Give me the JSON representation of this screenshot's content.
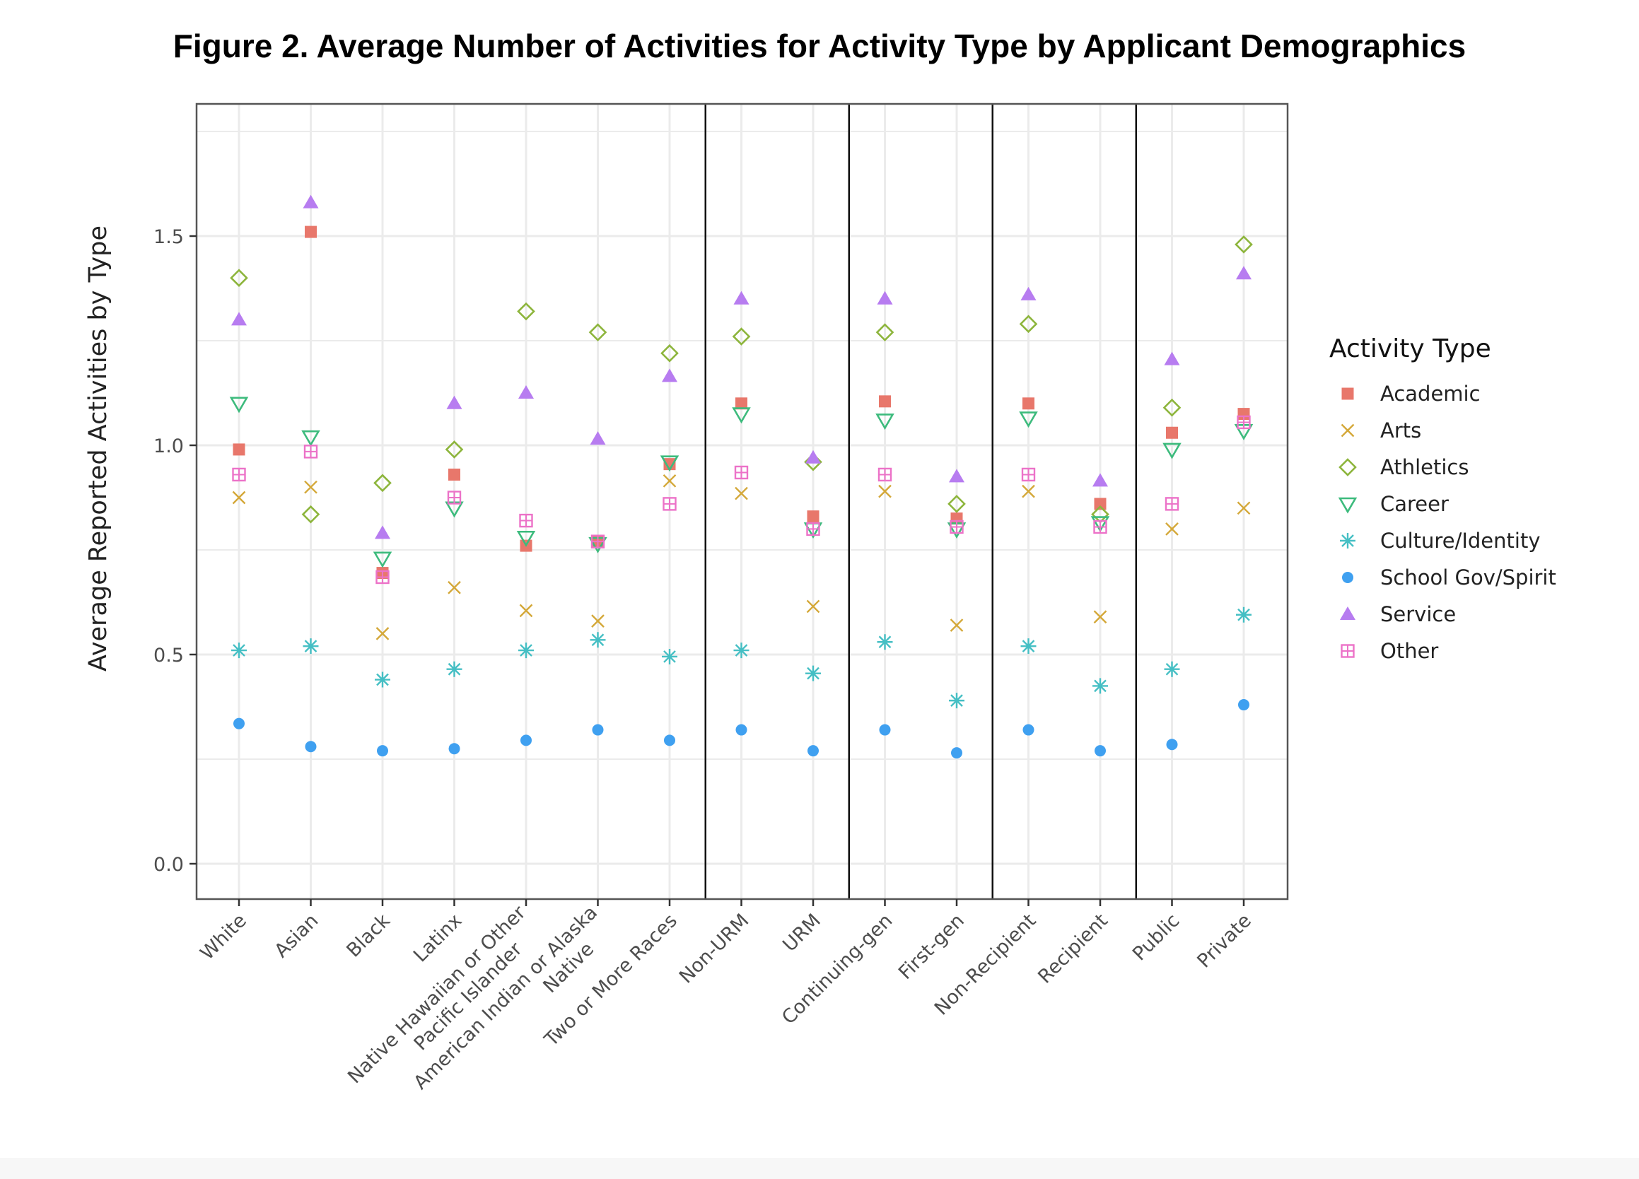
{
  "chart_data": {
    "type": "scatter",
    "title": "Figure 2. Average Number of Activities for Activity Type by Applicant Demographics",
    "xlabel": "",
    "ylabel": "Average Reported Activities by Type",
    "ylim": [
      -0.08,
      1.81
    ],
    "yticks": [
      0.0,
      0.5,
      1.0,
      1.5
    ],
    "ytick_labels": [
      "0.0",
      "0.5",
      "1.0",
      "1.5"
    ],
    "grid": true,
    "legend_title": "Activity Type",
    "legend_position": "right",
    "categories": [
      "White",
      "Asian",
      "Black",
      "Latinx",
      "Native Hawaiian or Other\nPacific Islander",
      "American Indian or Alaska\nNative",
      "Two or More Races",
      "Non-URM",
      "URM",
      "Continuing-gen",
      "First-gen",
      "Non-Recipient",
      "Recipient",
      "Public",
      "Private"
    ],
    "group_separators_after": [
      6,
      8,
      10,
      12
    ],
    "series": [
      {
        "name": "Academic",
        "shape": "square",
        "color": "#E8776B",
        "values": [
          0.99,
          1.51,
          0.695,
          0.93,
          0.76,
          0.77,
          0.955,
          1.1,
          0.83,
          1.105,
          0.825,
          1.1,
          0.86,
          1.03,
          1.075
        ]
      },
      {
        "name": "Arts",
        "shape": "x",
        "color": "#D4A839",
        "values": [
          0.875,
          0.9,
          0.55,
          0.66,
          0.605,
          0.58,
          0.915,
          0.885,
          0.615,
          0.89,
          0.57,
          0.89,
          0.59,
          0.8,
          0.85
        ]
      },
      {
        "name": "Athletics",
        "shape": "diamond-open",
        "color": "#8DB53C",
        "values": [
          1.4,
          0.835,
          0.91,
          0.99,
          1.32,
          1.27,
          1.22,
          1.26,
          0.96,
          1.27,
          0.86,
          1.29,
          0.835,
          1.09,
          1.48
        ]
      },
      {
        "name": "Career",
        "shape": "triangle-down-open",
        "color": "#3DBB7D",
        "values": [
          1.1,
          1.02,
          0.73,
          0.85,
          0.78,
          0.765,
          0.96,
          1.075,
          0.8,
          1.06,
          0.8,
          1.065,
          0.815,
          0.99,
          1.035
        ]
      },
      {
        "name": "Culture/Identity",
        "shape": "asterisk",
        "color": "#45BFC4",
        "values": [
          0.51,
          0.52,
          0.44,
          0.465,
          0.51,
          0.535,
          0.495,
          0.51,
          0.455,
          0.53,
          0.39,
          0.52,
          0.425,
          0.465,
          0.595
        ]
      },
      {
        "name": "School Gov/Spirit",
        "shape": "circle",
        "color": "#3FA0F0",
        "values": [
          0.335,
          0.28,
          0.27,
          0.275,
          0.295,
          0.32,
          0.295,
          0.32,
          0.27,
          0.32,
          0.265,
          0.32,
          0.27,
          0.285,
          0.38
        ]
      },
      {
        "name": "Service",
        "shape": "triangle-up",
        "color": "#B77CF0",
        "values": [
          1.3,
          1.58,
          0.79,
          1.1,
          1.125,
          1.015,
          1.165,
          1.35,
          0.97,
          1.35,
          0.925,
          1.36,
          0.915,
          1.205,
          1.41
        ]
      },
      {
        "name": "Other",
        "shape": "square-cross-open",
        "color": "#EC72C8",
        "values": [
          0.93,
          0.985,
          0.685,
          0.875,
          0.82,
          0.77,
          0.86,
          0.935,
          0.8,
          0.93,
          0.805,
          0.93,
          0.805,
          0.86,
          1.055
        ]
      }
    ]
  }
}
